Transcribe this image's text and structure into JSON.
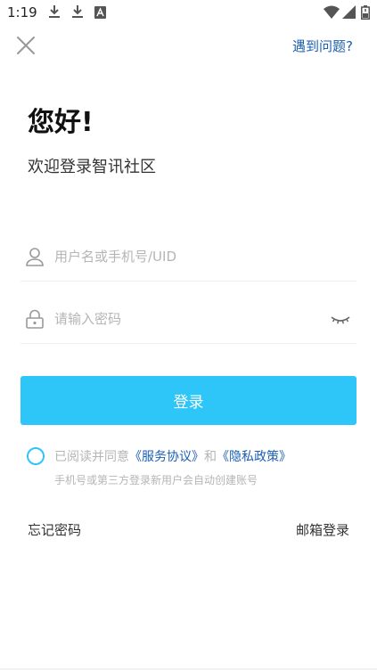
{
  "status_bar": {
    "time": "1:19",
    "left_icons": [
      "download-icon",
      "download-icon",
      "font-a-icon"
    ],
    "right_icons": [
      "wifi-icon",
      "signal-icon",
      "battery-icon"
    ]
  },
  "header": {
    "close_icon": "close-icon",
    "help_label": "遇到问题?"
  },
  "intro": {
    "greeting": "您好!",
    "welcome": "欢迎登录智讯社区"
  },
  "form": {
    "username": {
      "placeholder": "用户名或手机号/UID",
      "value": "",
      "icon": "user-icon"
    },
    "password": {
      "placeholder": "请输入密码",
      "value": "",
      "icon": "lock-icon",
      "toggle_icon": "eye-closed-icon"
    },
    "login_label": "登录"
  },
  "agreement": {
    "prefix": "已阅读并同意",
    "service_link": "《服务协议》",
    "and": "和",
    "privacy_link": "《隐私政策》",
    "note": "手机号或第三方登录新用户会自动创建账号",
    "checked": false
  },
  "footer": {
    "forgot_label": "忘记密码",
    "email_login_label": "邮箱登录"
  },
  "colors": {
    "accent": "#2ec5f8",
    "link": "#1a5fb4",
    "placeholder": "#b5b5b5",
    "text": "#333333"
  }
}
